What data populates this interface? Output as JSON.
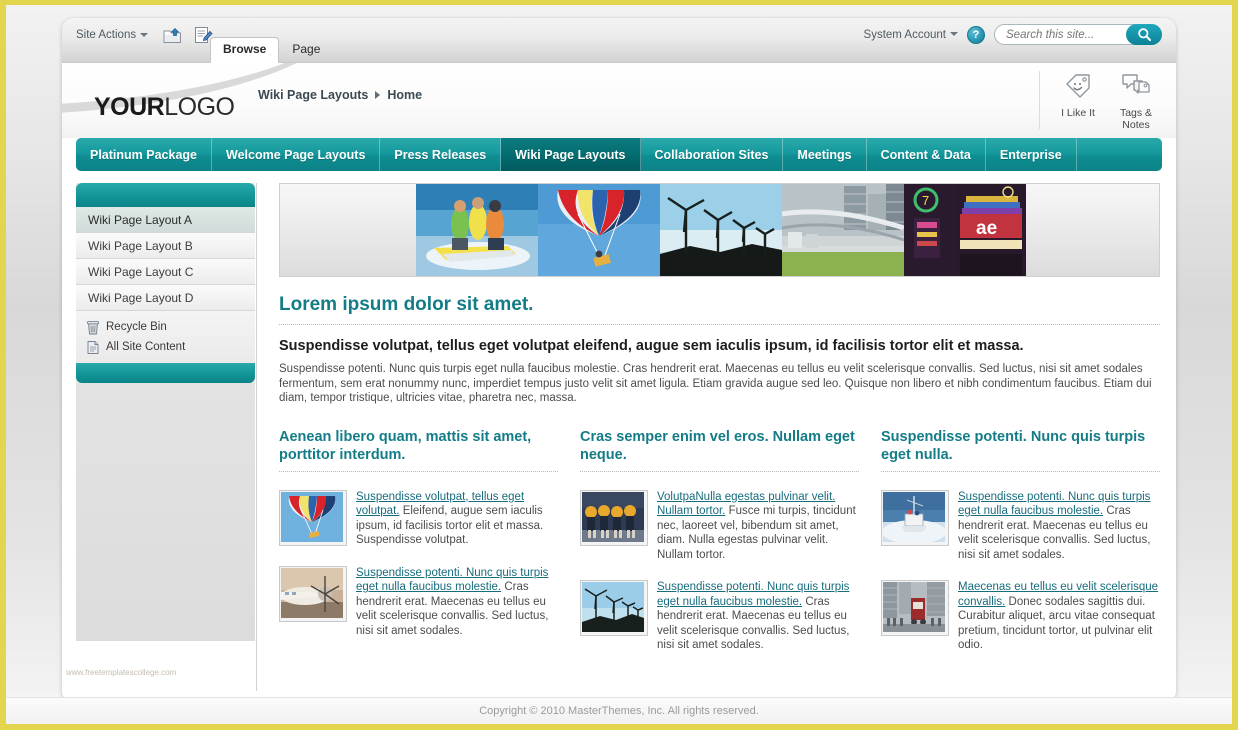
{
  "ribbon": {
    "site_actions": "Site Actions",
    "icons": [
      "navigate-up-icon",
      "edit-page-icon"
    ],
    "tabs": [
      {
        "label": "Browse",
        "active": true
      },
      {
        "label": "Page",
        "active": false
      }
    ],
    "account": "System Account",
    "help_glyph": "?",
    "search": {
      "placeholder": "Search this site...",
      "value": "",
      "button_icon": "search-icon"
    }
  },
  "header": {
    "logo_bold": "YOUR",
    "logo_light": "LOGO",
    "breadcrumb": [
      "Wiki Page Layouts",
      "Home"
    ],
    "social": [
      {
        "label": "I Like It",
        "icon": "tag-smiley-icon"
      },
      {
        "label": "Tags & Notes",
        "icon": "tags-notes-icon"
      }
    ]
  },
  "mainnav": {
    "items": [
      {
        "label": "Platinum Package",
        "active": false
      },
      {
        "label": "Welcome Page Layouts",
        "active": false
      },
      {
        "label": "Press Releases",
        "active": false
      },
      {
        "label": "Wiki Page Layouts",
        "active": true
      },
      {
        "label": "Collaboration Sites",
        "active": false
      },
      {
        "label": "Meetings",
        "active": false
      },
      {
        "label": "Content & Data",
        "active": false
      },
      {
        "label": "Enterprise",
        "active": false
      }
    ]
  },
  "sidebar": {
    "links": [
      {
        "label": "Wiki Page Layout A",
        "selected": true
      },
      {
        "label": "Wiki Page Layout B",
        "selected": false
      },
      {
        "label": "Wiki Page Layout C",
        "selected": false
      },
      {
        "label": "Wiki Page Layout D",
        "selected": false
      }
    ],
    "utilities": [
      {
        "label": "Recycle Bin",
        "icon": "recycle-bin-icon"
      },
      {
        "label": "All Site Content",
        "icon": "document-icon"
      }
    ],
    "watermark": "www.freetemplatescollege.com"
  },
  "content": {
    "banner_images": [
      "jetski-photo",
      "parasail-photo",
      "wind-turbines-photo",
      "architecture-photo",
      "neon-signs-photo"
    ],
    "title": "Lorem ipsum dolor sit amet.",
    "lead": "Suspendisse volutpat, tellus eget volutpat eleifend, augue sem iaculis ipsum, id facilisis tortor elit et massa.",
    "paragraph": "Suspendisse potenti. Nunc quis turpis eget nulla faucibus molestie. Cras hendrerit erat. Maecenas eu tellus eu velit scelerisque convallis. Sed luctus, nisi sit amet sodales fermentum, sem erat nonummy nunc, imperdiet tempus justo velit sit amet ligula. Etiam gravida augue sed leo. Quisque non libero et nibh condimentum faucibus. Etiam dui diam, tempor tristique, ultricies vitae, pharetra nec, massa.",
    "columns": [
      {
        "heading": "Aenean libero quam, mattis sit amet, porttitor interdum.",
        "articles": [
          {
            "thumb": "parasail-thumb",
            "link": "Suspendisse volutpat, tellus eget volutpat.",
            "text": "Eleifend, augue sem iaculis ipsum, id facilisis tortor elit et massa. Suspendisse volutpat."
          },
          {
            "thumb": "airplane-thumb",
            "link": "Suspendisse potenti. Nunc quis turpis eget nulla faucibus molestie.",
            "text": "Cras hendrerit erat. Maecenas eu tellus eu velit scelerisque convallis. Sed luctus, nisi sit amet sodales."
          }
        ]
      },
      {
        "heading": "Cras semper enim vel eros. Nullam eget neque.",
        "articles": [
          {
            "thumb": "runners-thumb",
            "link": "VolutpaNulla egestas pulvinar velit. Nullam tortor.",
            "text": "Fusce mi turpis, tincidunt nec, laoreet vel, bibendum sit amet, diam. Nulla egestas pulvinar velit. Nullam tortor."
          },
          {
            "thumb": "turbines-thumb",
            "link": "Suspendisse potenti. Nunc quis turpis eget nulla faucibus molestie.",
            "text": "Cras hendrerit erat. Maecenas eu tellus eu velit scelerisque convallis. Sed luctus, nisi sit amet sodales."
          }
        ]
      },
      {
        "heading": "Suspendisse potenti. Nunc quis turpis eget nulla.",
        "articles": [
          {
            "thumb": "sailboat-thumb",
            "link": "Suspendisse potenti. Nunc quis turpis eget nulla faucibus molestie.",
            "text": "Cras hendrerit erat. Maecenas eu tellus eu velit scelerisque convallis. Sed luctus, nisi sit amet sodales."
          },
          {
            "thumb": "city-street-thumb",
            "link": "Maecenas eu tellus eu velit scelerisque convallis.",
            "text": "Donec sodales sagittis dui. Curabitur aliquet, arcu vitae consequat pretium, tincidunt tortor, ut pulvinar elit odio."
          }
        ]
      }
    ]
  },
  "footer": {
    "copyright": "Copyright © 2010 MasterThemes, Inc. All rights reserved."
  },
  "colors": {
    "accent_teal": "#0e8e92",
    "heading_teal": "#147c87",
    "frame_yellow": "#e3d54e",
    "link_teal": "#176c7d"
  }
}
